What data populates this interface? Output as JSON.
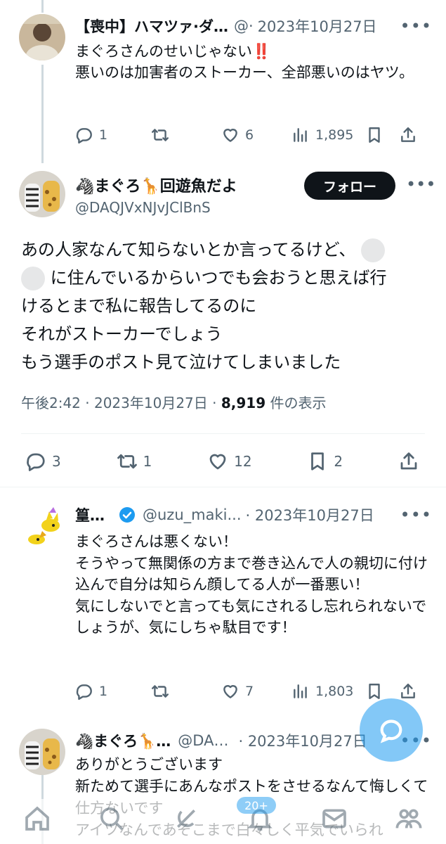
{
  "replies": [
    {
      "name": "【喪中】ハマツァ·ダ…",
      "handle": "@·",
      "time": "2023年10月27日",
      "text": "まぐろさんのせいじゃない‼️\n悪いのは加害者のストーカー、全部悪いのはヤツ。",
      "replies": "1",
      "retweets": "",
      "likes": "6",
      "views": "1,895"
    },
    {
      "name": "篁…",
      "handle": "@uzu_maki...",
      "time": "· 2023年10月27日",
      "text": "まぐろさんは悪くない！\nそうやって無関係の方まで巻き込んで人の親切に付け込んで自分は知らん顔してる人が一番悪い！\n気にしないでと言っても気にされるし忘れられないでしょうが、気にしちゃ駄目です！",
      "replies": "1",
      "retweets": "",
      "likes": "7",
      "views": "1,803"
    },
    {
      "name": "🦓まぐろ🦒…",
      "handle": "@DA…",
      "time": "· 2023年10月27日",
      "text": "ありがとうございます\n新ためて選手にあんなポストをさせるなんて悔しくて仕方ないです\nアイツなんであそこまで白々しく平気でいられ"
    }
  ],
  "main": {
    "name": "🦓まぐろ🦒回遊魚だよ",
    "handle": "@DAQJVxNJvJClBnS",
    "follow": "フォロー",
    "text_line1": "あの人家なんて知らないとか言ってるけど、",
    "text_line2": "に住んでいるからいつでも会おうと思えば行",
    "text_rest": "けるとまで私に報告してるのに\nそれがストーカーでしょう\nもう選手のポスト見て泣けてしまいました",
    "time": "午後2:42 · 2023年10月27日 · ",
    "views": "8,919",
    "views_label": " 件の表示",
    "replies": "3",
    "retweets": "1",
    "likes": "12",
    "bookmarks": "2"
  },
  "nav": {
    "badge": "20+"
  },
  "colors": {
    "accent": "#1d9bf0",
    "text": "#0f1419",
    "muted": "#536471",
    "verified": "#1d9bf0"
  }
}
